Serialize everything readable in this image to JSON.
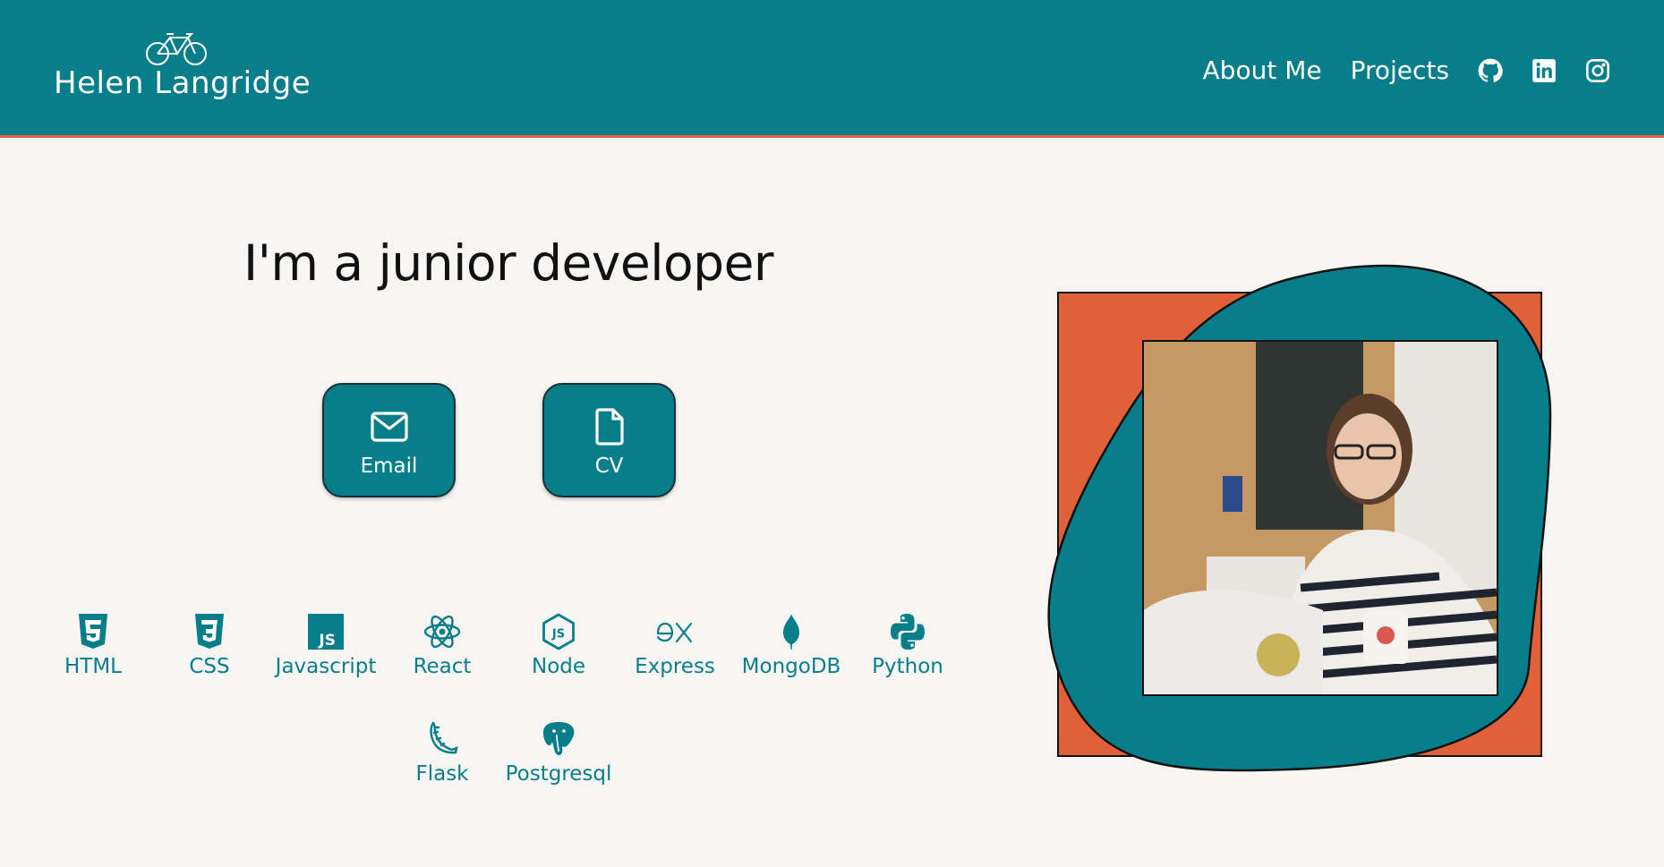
{
  "header": {
    "site_name": "Helen Langridge",
    "logo_icon": "bicycle-icon",
    "nav": {
      "about_label": "About Me",
      "projects_label": "Projects"
    },
    "social_icons": [
      "github-icon",
      "linkedin-icon",
      "instagram-icon"
    ]
  },
  "hero": {
    "headline": "I'm a junior developer",
    "buttons": {
      "email_label": "Email",
      "cv_label": "CV"
    }
  },
  "skills": [
    {
      "label": "HTML",
      "icon": "html5-icon"
    },
    {
      "label": "CSS",
      "icon": "css3-icon"
    },
    {
      "label": "Javascript",
      "icon": "javascript-icon"
    },
    {
      "label": "React",
      "icon": "react-icon"
    },
    {
      "label": "Node",
      "icon": "node-icon"
    },
    {
      "label": "Express",
      "icon": "express-icon"
    },
    {
      "label": "MongoDB",
      "icon": "mongodb-icon"
    },
    {
      "label": "Python",
      "icon": "python-icon"
    },
    {
      "label": "Flask",
      "icon": "flask-icon"
    },
    {
      "label": "Postgresql",
      "icon": "postgresql-icon"
    }
  ],
  "colors": {
    "primary": "#087e8b",
    "accent": "#e0603a",
    "background": "#f7f6f4",
    "text": "#111111"
  }
}
